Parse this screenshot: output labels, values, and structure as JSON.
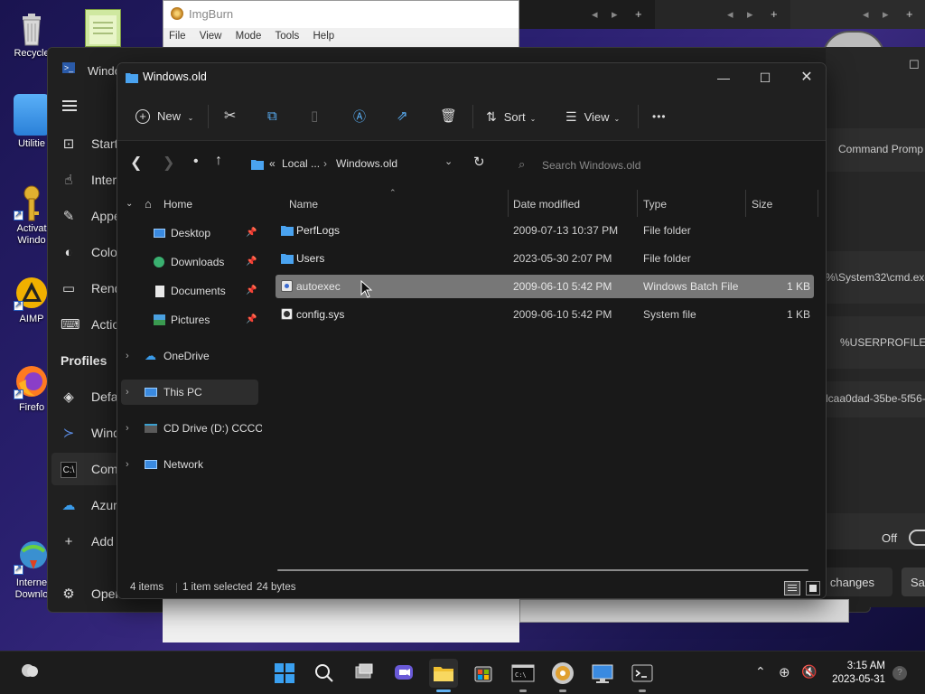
{
  "desktop": {
    "icons": [
      {
        "label": "Recycle",
        "icon": "recycle-bin-icon"
      },
      {
        "label": "Utilitie",
        "icon": "folder-icon"
      },
      {
        "label": "Activat Windo",
        "icon": "key-icon"
      },
      {
        "label": "AIMP",
        "icon": "aimp-icon"
      },
      {
        "label": "Firefo",
        "icon": "firefox-icon"
      },
      {
        "label": "Interne Downlo",
        "icon": "idm-icon"
      }
    ]
  },
  "imgburn": {
    "title": "ImgBurn",
    "menu": [
      "File",
      "View",
      "Mode",
      "Tools",
      "Help"
    ]
  },
  "terminal_settings": {
    "title": "Windo",
    "nav": [
      {
        "label": "Startu",
        "icon": "startup-icon"
      },
      {
        "label": "Intera",
        "icon": "interaction-icon"
      },
      {
        "label": "Appea",
        "icon": "appearance-icon"
      },
      {
        "label": "Colo",
        "icon": "color-schemes-icon"
      },
      {
        "label": "Rend",
        "icon": "rendering-icon"
      },
      {
        "label": "Actio",
        "icon": "actions-icon"
      }
    ],
    "profiles_header": "Profiles",
    "profiles": [
      {
        "label": "Defa",
        "icon": "defaults-icon"
      },
      {
        "label": "Windo",
        "icon": "powershell-icon"
      },
      {
        "label": "Com",
        "icon": "cmd-icon"
      },
      {
        "label": "Azur",
        "icon": "azure-icon"
      },
      {
        "label": "Add",
        "icon": "add-icon"
      },
      {
        "label": "Open",
        "icon": "gear-icon"
      }
    ],
    "right_panel": {
      "name_value": "Command Promp",
      "cmdline_value": "%\\System32\\cmd.exe",
      "start_dir_value": "%USERPROFILE%",
      "guid_value": "lcaa0dad-35be-5f56-",
      "toggle_label": "Off",
      "save_label": "d changes",
      "sa_label": "Sa"
    }
  },
  "explorer": {
    "title": "Windows.old",
    "toolbar": {
      "new_label": "New",
      "sort_label": "Sort",
      "view_label": "View",
      "more_label": "•••"
    },
    "address": {
      "overflow": "«",
      "crumbs": [
        "Local ...",
        "Windows.old"
      ]
    },
    "search": {
      "placeholder": "Search Windows.old"
    },
    "nav": {
      "home": "Home",
      "desktop": "Desktop",
      "downloads": "Downloads",
      "documents": "Documents",
      "pictures": "Pictures",
      "onedrive": "OneDrive",
      "thispc": "This PC",
      "cddrive": "CD Drive (D:) CCCOM",
      "network": "Network"
    },
    "columns": {
      "name": "Name",
      "date": "Date modified",
      "type": "Type",
      "size": "Size"
    },
    "files": [
      {
        "name": "PerfLogs",
        "date": "2009-07-13 10:37 PM",
        "type": "File folder",
        "size": "",
        "icon": "folder-icon"
      },
      {
        "name": "Users",
        "date": "2023-05-30 2:07 PM",
        "type": "File folder",
        "size": "",
        "icon": "folder-icon"
      },
      {
        "name": "autoexec",
        "date": "2009-06-10 5:42 PM",
        "type": "Windows Batch File",
        "size": "1 KB",
        "icon": "batch-file-icon"
      },
      {
        "name": "config.sys",
        "date": "2009-06-10 5:42 PM",
        "type": "System file",
        "size": "1 KB",
        "icon": "system-file-icon"
      }
    ],
    "status": {
      "count": "4 items",
      "selected": "1 item selected",
      "bytes": "24 bytes"
    }
  },
  "taskbar": {
    "time": "3:15 AM",
    "date": "2023-05-31"
  },
  "colors": {
    "accent_folder": "#4aa3f0",
    "selection": "#777777",
    "explorer_bg": "#191919"
  }
}
